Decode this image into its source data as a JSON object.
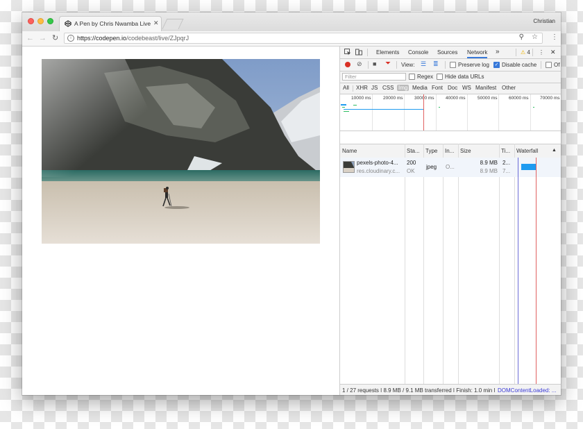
{
  "window": {
    "profile": "Christian",
    "tab_title": "A Pen by Chris Nwamba Live P",
    "url_host": "https://codepen.io",
    "url_path": "/codebeast/live/ZJpqrJ"
  },
  "devtools": {
    "tabs": [
      "Elements",
      "Console",
      "Sources",
      "Network"
    ],
    "active_tab": "Network",
    "more": "»",
    "warning_count": "4",
    "view_label": "View:",
    "preserve_log": "Preserve log",
    "disable_cache": "Disable cache",
    "offline": "Of",
    "filter_placeholder": "Filter",
    "regex": "Regex",
    "hide_data_urls": "Hide data URLs",
    "types": [
      "All",
      "XHR",
      "JS",
      "CSS",
      "Img",
      "Media",
      "Font",
      "Doc",
      "WS",
      "Manifest",
      "Other"
    ],
    "active_type": "Img",
    "overview_ticks": [
      "10000 ms",
      "20000 ms",
      "30000 ms",
      "40000 ms",
      "50000 ms",
      "60000 ms",
      "70000 ms"
    ],
    "columns": [
      "Name",
      "Sta...",
      "Type",
      "In...",
      "Size",
      "Ti...",
      "Waterfall"
    ],
    "request": {
      "name": "pexels-photo-4...",
      "domain": "res.cloudinary.c...",
      "status_code": "200",
      "status_text": "OK",
      "type": "jpeg",
      "initiator": "O...",
      "size": "8.9 MB",
      "content_size": "8.9 MB",
      "time": "2...",
      "latency": "7..."
    },
    "status": {
      "summary": "1 / 27 requests ǀ 8.9 MB / 9.1 MB transferred ǀ Finish: 1.0 min ǀ",
      "dcl": "DOMContentLoaded: ..."
    }
  },
  "colors": {
    "accent": "#3879d9",
    "record": "#d93025",
    "waterfall_bar": "#1e9bf0",
    "warning": "#f0b400"
  }
}
